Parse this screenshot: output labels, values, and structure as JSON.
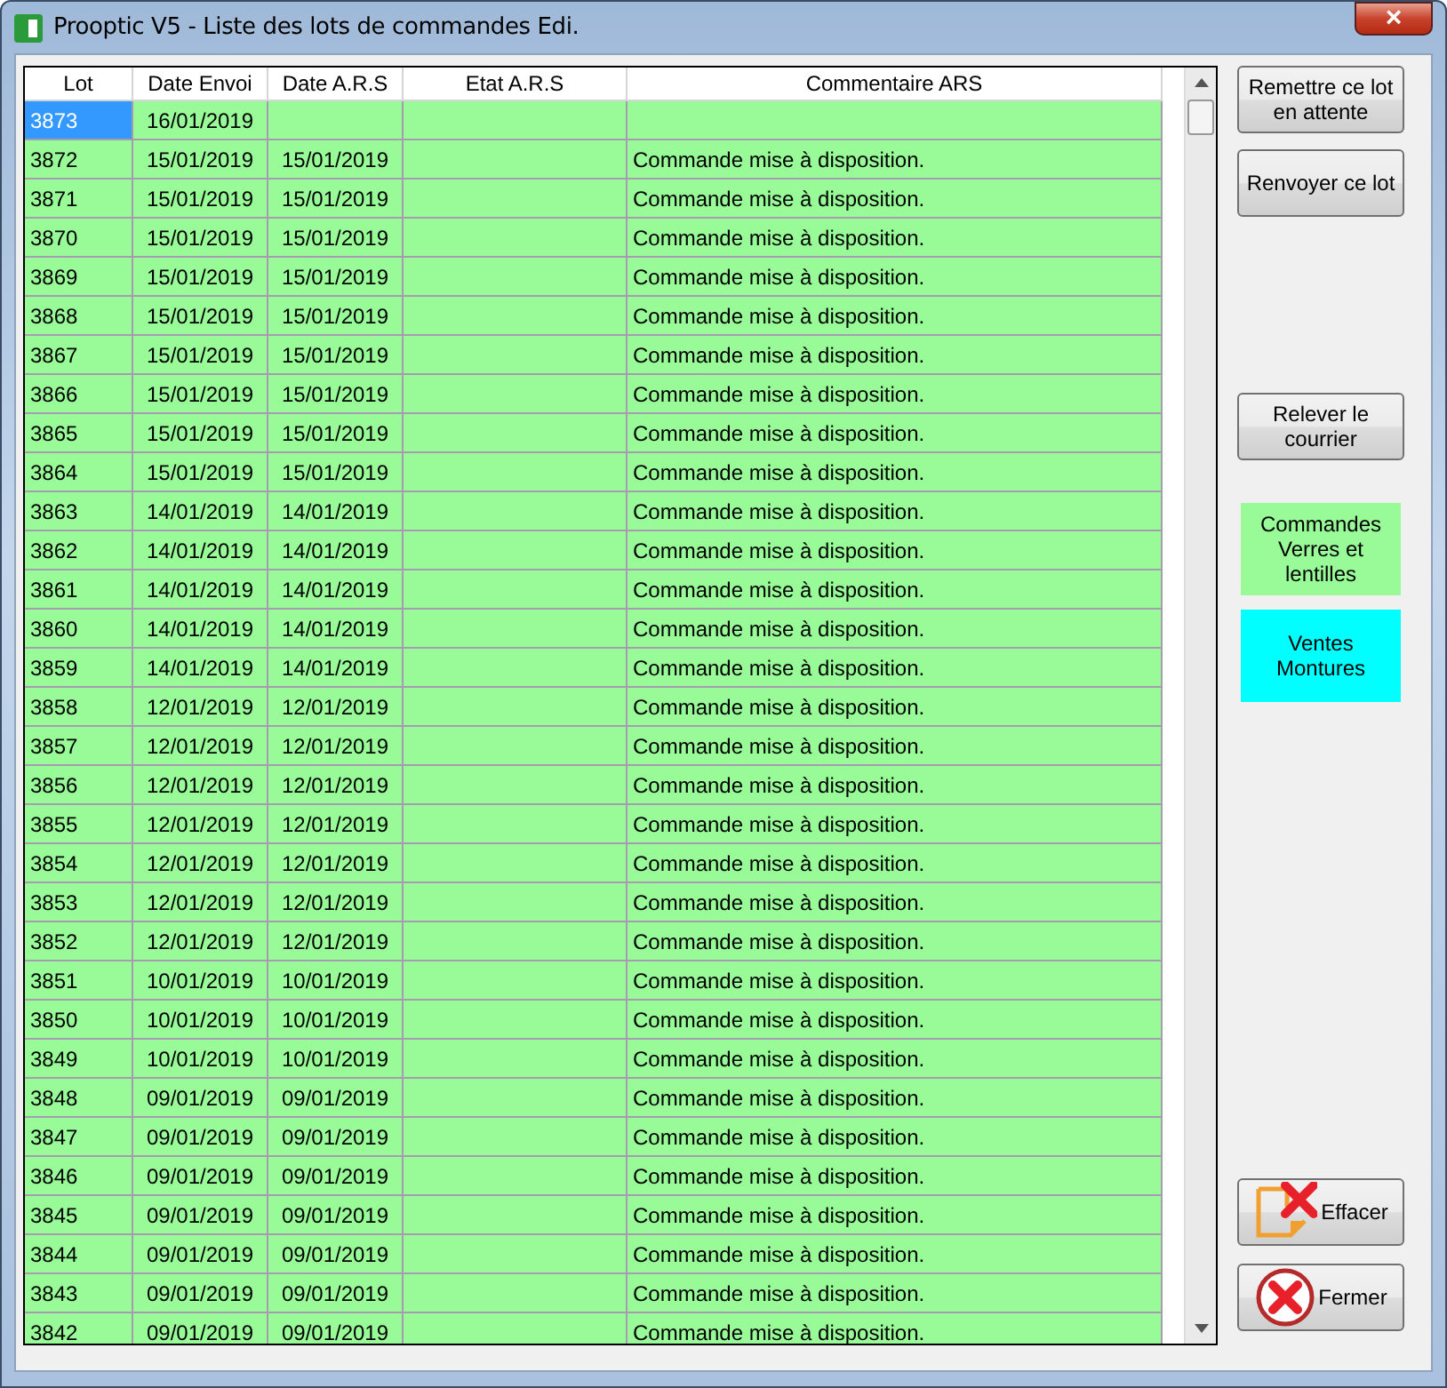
{
  "window": {
    "title": "Prooptic V5 - Liste des lots de commandes Edi.",
    "close": "×"
  },
  "table": {
    "columns": [
      "Lot",
      "Date Envoi",
      "Date A.R.S",
      "Etat A.R.S",
      "Commentaire ARS"
    ],
    "rows": [
      {
        "selected": true,
        "cells": [
          "3873",
          "16/01/2019",
          "",
          "",
          ""
        ]
      },
      {
        "selected": false,
        "cells": [
          "3872",
          "15/01/2019",
          "15/01/2019",
          "",
          "Commande mise à disposition."
        ]
      },
      {
        "selected": false,
        "cells": [
          "3871",
          "15/01/2019",
          "15/01/2019",
          "",
          "Commande mise à disposition."
        ]
      },
      {
        "selected": false,
        "cells": [
          "3870",
          "15/01/2019",
          "15/01/2019",
          "",
          "Commande mise à disposition."
        ]
      },
      {
        "selected": false,
        "cells": [
          "3869",
          "15/01/2019",
          "15/01/2019",
          "",
          "Commande mise à disposition."
        ]
      },
      {
        "selected": false,
        "cells": [
          "3868",
          "15/01/2019",
          "15/01/2019",
          "",
          "Commande mise à disposition."
        ]
      },
      {
        "selected": false,
        "cells": [
          "3867",
          "15/01/2019",
          "15/01/2019",
          "",
          "Commande mise à disposition."
        ]
      },
      {
        "selected": false,
        "cells": [
          "3866",
          "15/01/2019",
          "15/01/2019",
          "",
          "Commande mise à disposition."
        ]
      },
      {
        "selected": false,
        "cells": [
          "3865",
          "15/01/2019",
          "15/01/2019",
          "",
          "Commande mise à disposition."
        ]
      },
      {
        "selected": false,
        "cells": [
          "3864",
          "15/01/2019",
          "15/01/2019",
          "",
          "Commande mise à disposition."
        ]
      },
      {
        "selected": false,
        "cells": [
          "3863",
          "14/01/2019",
          "14/01/2019",
          "",
          "Commande mise à disposition."
        ]
      },
      {
        "selected": false,
        "cells": [
          "3862",
          "14/01/2019",
          "14/01/2019",
          "",
          "Commande mise à disposition."
        ]
      },
      {
        "selected": false,
        "cells": [
          "3861",
          "14/01/2019",
          "14/01/2019",
          "",
          "Commande mise à disposition."
        ]
      },
      {
        "selected": false,
        "cells": [
          "3860",
          "14/01/2019",
          "14/01/2019",
          "",
          "Commande mise à disposition."
        ]
      },
      {
        "selected": false,
        "cells": [
          "3859",
          "14/01/2019",
          "14/01/2019",
          "",
          "Commande mise à disposition."
        ]
      },
      {
        "selected": false,
        "cells": [
          "3858",
          "12/01/2019",
          "12/01/2019",
          "",
          "Commande mise à disposition."
        ]
      },
      {
        "selected": false,
        "cells": [
          "3857",
          "12/01/2019",
          "12/01/2019",
          "",
          "Commande mise à disposition."
        ]
      },
      {
        "selected": false,
        "cells": [
          "3856",
          "12/01/2019",
          "12/01/2019",
          "",
          "Commande mise à disposition."
        ]
      },
      {
        "selected": false,
        "cells": [
          "3855",
          "12/01/2019",
          "12/01/2019",
          "",
          "Commande mise à disposition."
        ]
      },
      {
        "selected": false,
        "cells": [
          "3854",
          "12/01/2019",
          "12/01/2019",
          "",
          "Commande mise à disposition."
        ]
      },
      {
        "selected": false,
        "cells": [
          "3853",
          "12/01/2019",
          "12/01/2019",
          "",
          "Commande mise à disposition."
        ]
      },
      {
        "selected": false,
        "cells": [
          "3852",
          "12/01/2019",
          "12/01/2019",
          "",
          "Commande mise à disposition."
        ]
      },
      {
        "selected": false,
        "cells": [
          "3851",
          "10/01/2019",
          "10/01/2019",
          "",
          "Commande mise à disposition."
        ]
      },
      {
        "selected": false,
        "cells": [
          "3850",
          "10/01/2019",
          "10/01/2019",
          "",
          "Commande mise à disposition."
        ]
      },
      {
        "selected": false,
        "cells": [
          "3849",
          "10/01/2019",
          "10/01/2019",
          "",
          "Commande mise à disposition."
        ]
      },
      {
        "selected": false,
        "cells": [
          "3848",
          "09/01/2019",
          "09/01/2019",
          "",
          "Commande mise à disposition."
        ]
      },
      {
        "selected": false,
        "cells": [
          "3847",
          "09/01/2019",
          "09/01/2019",
          "",
          "Commande mise à disposition."
        ]
      },
      {
        "selected": false,
        "cells": [
          "3846",
          "09/01/2019",
          "09/01/2019",
          "",
          "Commande mise à disposition."
        ]
      },
      {
        "selected": false,
        "cells": [
          "3845",
          "09/01/2019",
          "09/01/2019",
          "",
          "Commande mise à disposition."
        ]
      },
      {
        "selected": false,
        "cells": [
          "3844",
          "09/01/2019",
          "09/01/2019",
          "",
          "Commande mise à disposition."
        ]
      },
      {
        "selected": false,
        "cells": [
          "3843",
          "09/01/2019",
          "09/01/2019",
          "",
          "Commande mise à disposition."
        ]
      },
      {
        "selected": false,
        "cells": [
          "3842",
          "09/01/2019",
          "09/01/2019",
          "",
          "Commande mise à disposition."
        ]
      }
    ]
  },
  "side_buttons": [
    {
      "label": "Remettre ce lot en attente"
    },
    {
      "label": "Renvoyer ce lot"
    },
    {
      "label": "Relever le courrier"
    }
  ],
  "legend": [
    {
      "label": "Commandes Verres et lentilles",
      "color": "#98fb98"
    },
    {
      "label": "Ventes Montures",
      "color": "#00ffff"
    }
  ],
  "bottom_buttons": [
    {
      "kind": "erase",
      "label": "Effacer"
    },
    {
      "kind": "close",
      "label": "Fermer"
    }
  ]
}
